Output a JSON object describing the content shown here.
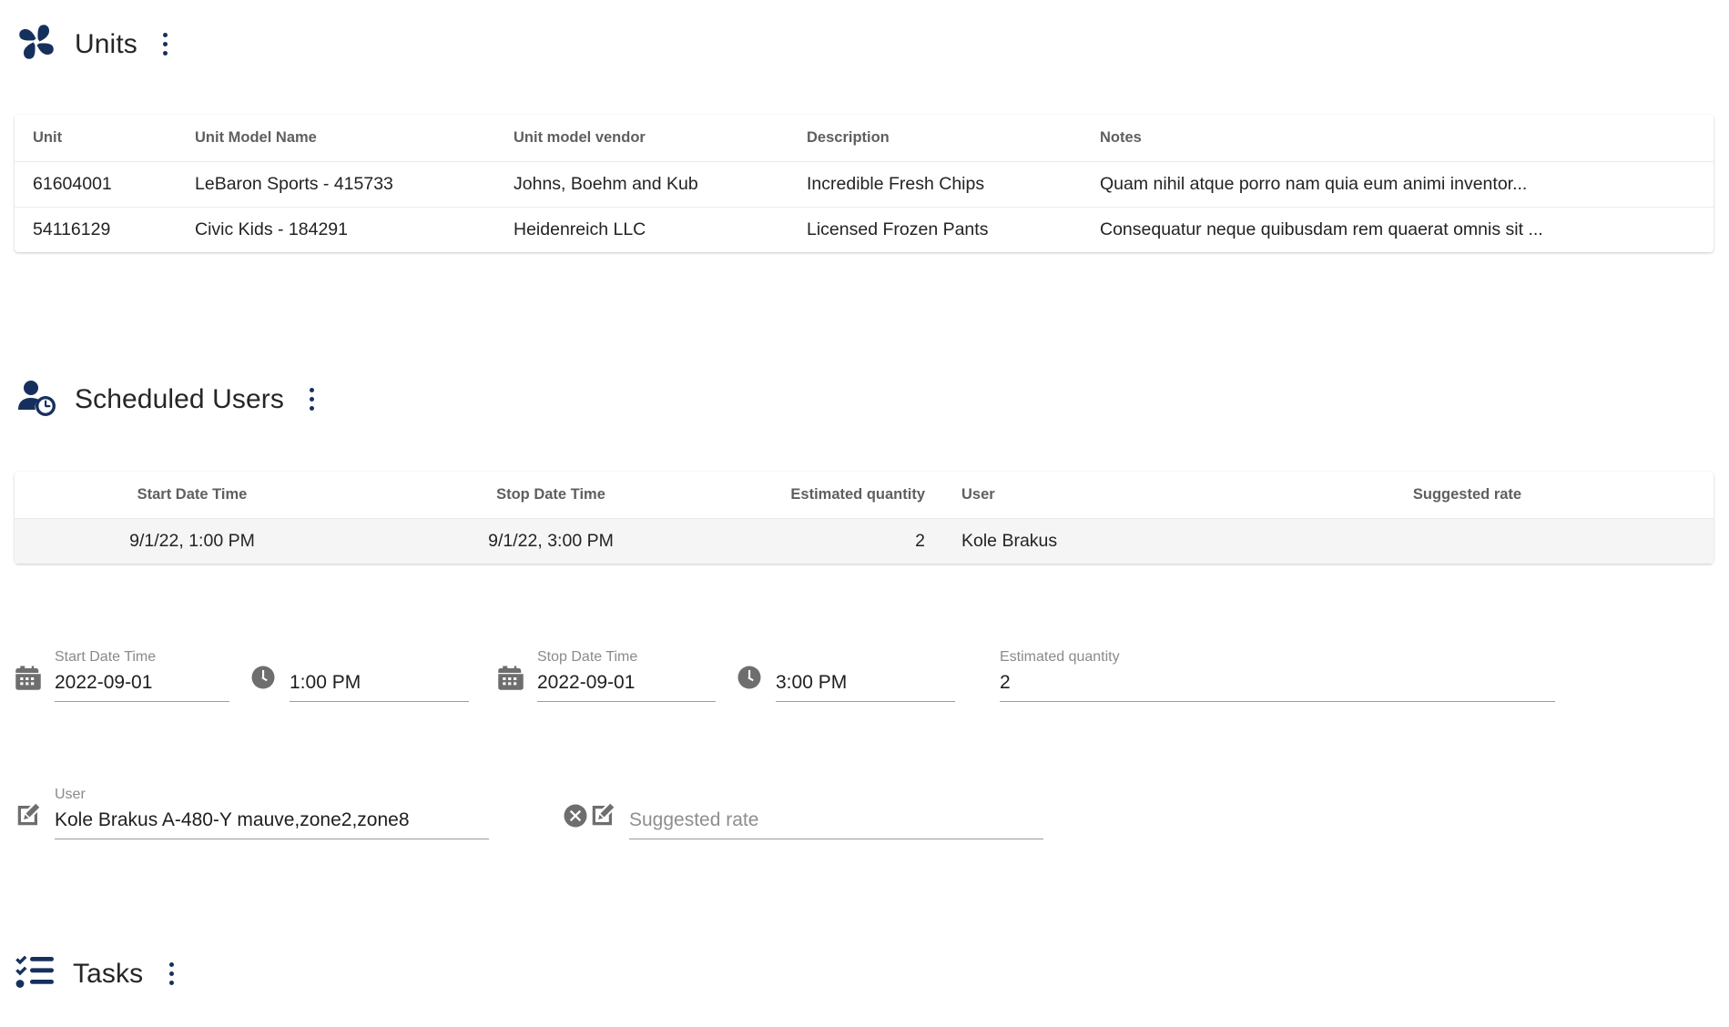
{
  "units_section": {
    "title": "Units",
    "icon": "pinwheel-icon",
    "menu_icon": "kebab-menu-icon",
    "table": {
      "columns": [
        "Unit",
        "Unit Model Name",
        "Unit model vendor",
        "Description",
        "Notes"
      ],
      "rows": [
        {
          "unit": "61604001",
          "unit_model_name": "LeBaron Sports - 415733",
          "unit_model_vendor": "Johns, Boehm and Kub",
          "description": "Incredible Fresh Chips",
          "notes": "Quam nihil atque porro nam quia eum animi inventor..."
        },
        {
          "unit": "54116129",
          "unit_model_name": "Civic Kids - 184291",
          "unit_model_vendor": "Heidenreich LLC",
          "description": "Licensed Frozen Pants",
          "notes": "Consequatur neque quibusdam rem quaerat omnis sit ..."
        }
      ]
    }
  },
  "scheduled_users_section": {
    "title": "Scheduled Users",
    "icon": "user-clock-icon",
    "menu_icon": "kebab-menu-icon",
    "table": {
      "columns": [
        "Start Date Time",
        "Stop Date Time",
        "Estimated quantity",
        "User",
        "Suggested rate"
      ],
      "rows": [
        {
          "start_date_time": "9/1/22, 1:00 PM",
          "stop_date_time": "9/1/22, 3:00 PM",
          "estimated_quantity": "2",
          "user": "Kole Brakus",
          "suggested_rate": ""
        }
      ]
    },
    "form": {
      "start_date": {
        "label": "Start Date Time",
        "value": "2022-09-01",
        "icon": "calendar-icon"
      },
      "start_time": {
        "label": "",
        "value": "1:00 PM",
        "icon": "clock-icon"
      },
      "stop_date": {
        "label": "Stop Date Time",
        "value": "2022-09-01",
        "icon": "calendar-icon"
      },
      "stop_time": {
        "label": "",
        "value": "3:00 PM",
        "icon": "clock-icon"
      },
      "estimated_quantity": {
        "label": "Estimated quantity",
        "value": "2"
      },
      "user": {
        "label": "User",
        "value": "Kole Brakus A-480-Y mauve,zone2,zone8",
        "icon": "edit-icon",
        "clear_icon": "clear-circle-icon"
      },
      "suggested_rate": {
        "label": "",
        "value": "",
        "placeholder": "Suggested rate",
        "icon": "edit-icon"
      }
    }
  },
  "tasks_section": {
    "title": "Tasks",
    "icon": "checklist-icon",
    "menu_icon": "kebab-menu-icon"
  },
  "theme": {
    "brand_navy": "#16305e",
    "selected_row_bg": "#f5f5f5",
    "header_text": "#5f5f5f",
    "icon_gray": "#6e6e6e"
  }
}
